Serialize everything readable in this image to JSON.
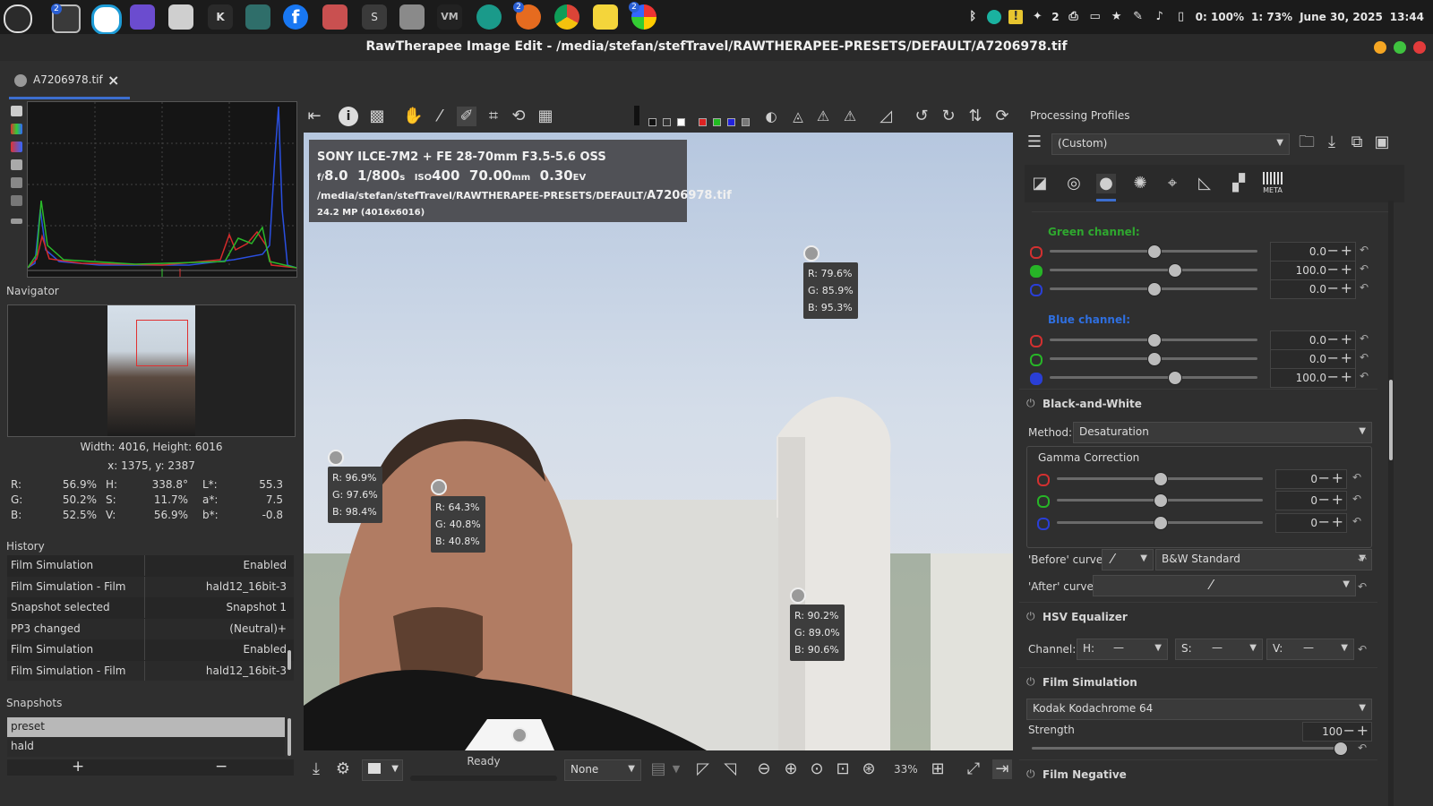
{
  "taskbar": {
    "apps": [
      "start-menu",
      "terminal",
      "messaging-app",
      "mastodon",
      "file-manager",
      "keepass",
      "bird-app",
      "facebook",
      "game-app",
      "stephanie-app",
      "settings",
      "vm-app",
      "chameleon-app",
      "firefox",
      "chrome",
      "notes-app",
      "rawtherapee"
    ],
    "badges": {
      "terminal": "2",
      "firefox": "2",
      "rawtherapee": "2"
    },
    "notif_count": "2",
    "battery": "0: 100%",
    "battery2": "1: 73%",
    "date": "June 30, 2025",
    "time": "13:44"
  },
  "window": {
    "title": "RawTherapee Image Edit - /media/stefan/stefTravel/RAWTHERAPEE-PRESETS/DEFAULT/A7206978.tif",
    "tab_label": "A7206978.tif",
    "tab_close": "×"
  },
  "navigator": {
    "label": "Navigator",
    "dimensions": "Width: 4016, Height: 6016",
    "coords": "x: 1375, y: 2387",
    "values": [
      [
        "R:",
        "56.9%",
        "H:",
        "338.8°",
        "L*:",
        "55.3"
      ],
      [
        "G:",
        "50.2%",
        "S:",
        "11.7%",
        "a*:",
        "7.5"
      ],
      [
        "B:",
        "52.5%",
        "V:",
        "56.9%",
        "b*:",
        "-0.8"
      ]
    ]
  },
  "history": {
    "label": "History",
    "rows": [
      {
        "name": "Film Simulation",
        "value": "Enabled"
      },
      {
        "name": "Film Simulation - Film",
        "value": "hald12_16bit-3"
      },
      {
        "name": "Snapshot selected",
        "value": "Snapshot 1"
      },
      {
        "name": "PP3 changed",
        "value": "(Neutral)+"
      },
      {
        "name": "Film Simulation",
        "value": "Enabled"
      },
      {
        "name": "Film Simulation - Film",
        "value": "hald12_16bit-3"
      }
    ]
  },
  "snapshots": {
    "label": "Snapshots",
    "items": [
      "preset",
      "hald"
    ],
    "add": "+",
    "remove": "−"
  },
  "image_info": {
    "camera": "SONY ILCE-7M2 + FE 28-70mm F3.5-5.6 OSS",
    "aperture": "8.0",
    "shutter": "1/800",
    "iso": "400",
    "focal": "70.00",
    "ev": "0.30",
    "path_prefix": "/media/stefan/stefTravel/RAWTHERAPEE-PRESETS/DEFAULT/",
    "filename": "A7206978.tif",
    "mp": "24.2 MP (4016x6016)",
    "u_f": "f/",
    "u_s": "s",
    "u_iso": "ISO",
    "u_mm": "mm",
    "u_ev": "EV"
  },
  "probes": [
    {
      "r": "R: 79.6%",
      "g": "G: 85.9%",
      "b": "B: 95.3%"
    },
    {
      "r": "R: 96.9%",
      "g": "G: 97.6%",
      "b": "B: 98.4%"
    },
    {
      "r": "R: 64.3%",
      "g": "G: 40.8%",
      "b": "B: 40.8%"
    },
    {
      "r": "R: 90.2%",
      "g": "G: 89.0%",
      "b": "B: 90.6%"
    }
  ],
  "bottombar": {
    "status": "Ready",
    "preview_mode": "None",
    "zoom": "33%"
  },
  "processing_profiles": {
    "label": "Processing Profiles",
    "value": "(Custom)"
  },
  "channel_mixer": {
    "green_label": "Green channel:",
    "blue_label": "Blue channel:",
    "green_values": [
      "0.0",
      "100.0",
      "0.0"
    ],
    "green_levels": [
      0.0,
      1.0,
      0.0
    ],
    "blue_values": [
      "0.0",
      "0.0",
      "100.0"
    ],
    "blue_levels": [
      0.0,
      0.0,
      1.0
    ]
  },
  "black_white": {
    "title": "Black-and-White",
    "method_label": "Method:",
    "method_value": "Desaturation",
    "gamma_label": "Gamma Correction",
    "gamma_values": [
      "0",
      "0",
      "0"
    ],
    "before_label": "'Before' curve:",
    "before_value": "B&W Standard",
    "after_label": "'After' curve:"
  },
  "hsv": {
    "title": "HSV Equalizer",
    "channel_label": "Channel:",
    "h": "H:",
    "s": "S:",
    "v": "V:",
    "dash": "—"
  },
  "film_sim": {
    "title": "Film Simulation",
    "film": "Kodak Kodachrome 64",
    "strength_label": "Strength",
    "strength_value": "100",
    "strength_level": 1.0
  },
  "film_neg": {
    "title": "Film Negative"
  },
  "tool_tabs": {
    "meta_label": "META"
  },
  "colors": {
    "accent": "#3c6ecf",
    "green_text": "#2fa82f",
    "blue_text": "#2f6fe0",
    "red_dot": "#d23030",
    "green_dot": "#27b527",
    "blue_dot": "#2a3fd6"
  }
}
